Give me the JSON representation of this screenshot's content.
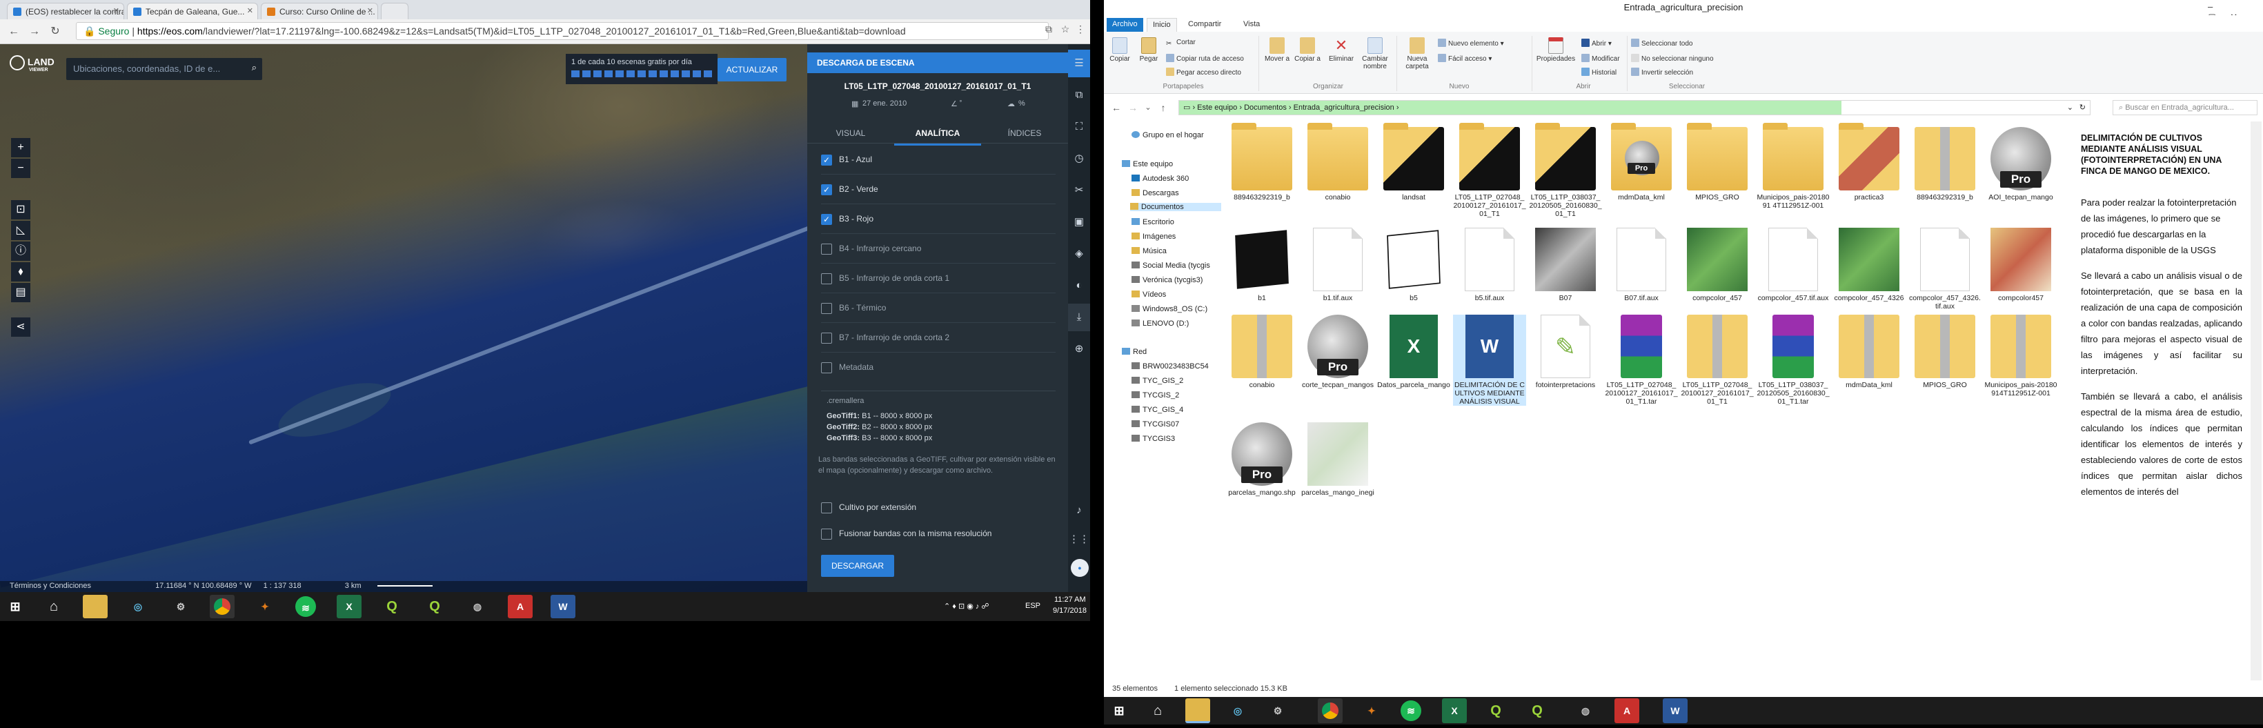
{
  "browser": {
    "tabs": [
      {
        "title": "(EOS) restablecer la contra..."
      },
      {
        "title": "Tecpán de Galeana, Gue..."
      },
      {
        "title": "Curso: Curso Online de ..."
      }
    ],
    "secure_label": "Seguro",
    "url_host": "https://eos.com",
    "url_path": "/landviewer/?lat=17.21197&lng=-100.68249&z=12&s=Landsat5(TM)&id=LT05_L1TP_027048_20100127_20161017_01_T1&b=Red,Green,Blue&anti&tab=download"
  },
  "map": {
    "logo_text": "LAND",
    "logo_sub": "VIEWER",
    "search_placeholder": "Ubicaciones, coordenadas, ID de e...",
    "promo_text": "1 de cada 10 escenas gratis por día",
    "update_button": "ACTUALIZAR",
    "status_terms": "Términos y Condiciones",
    "status_coords": "17.11684 ° N 100.68489 ° W",
    "status_scale": "1 : 137 318",
    "status_distance": "3 km"
  },
  "panel": {
    "header": "DESCARGA DE ESCENA",
    "scene_id": "LT05_L1TP_027048_20100127_20161017_01_T1",
    "date": "27 ene. 2010",
    "cloud": "%",
    "tabs": [
      "VISUAL",
      "ANALÍTICA",
      "ÍNDICES"
    ],
    "bands": [
      {
        "label": "B1 - Azul",
        "checked": true
      },
      {
        "label": "B2 - Verde",
        "checked": true
      },
      {
        "label": "B3 - Rojo",
        "checked": true
      },
      {
        "label": "B4 - Infrarrojo cercano",
        "checked": false
      },
      {
        "label": "B5 - Infrarrojo de onda corta 1",
        "checked": false
      },
      {
        "label": "B6 - Térmico",
        "checked": false
      },
      {
        "label": "B7 - Infrarrojo de onda corta 2",
        "checked": false
      },
      {
        "label": "Metadata",
        "checked": false
      }
    ],
    "zip_title": ".cremallera",
    "zip_lines": [
      {
        "name": "GeoTiff1:",
        "value": "B1 -- 8000 x 8000 px"
      },
      {
        "name": "GeoTiff2:",
        "value": "B2 -- 8000 x 8000 px"
      },
      {
        "name": "GeoTiff3:",
        "value": "B3 -- 8000 x 8000 px"
      }
    ],
    "note": "Las bandas seleccionadas a GeoTIFF, cultivar por extensión visible en el mapa (opcionalmente) y descargar como archivo.",
    "options": [
      "Cultivo por extensión",
      "Fusionar bandas con la misma resolución"
    ],
    "download_button": "DESCARGAR"
  },
  "taskbar_left": {
    "lang": "ESP",
    "time": "11:27 AM",
    "date": "9/17/2018"
  },
  "explorer": {
    "title": "Entrada_agricultura_precision",
    "tabs": [
      "Archivo",
      "Inicio",
      "Compartir",
      "Vista"
    ],
    "ribbon": {
      "copiar": "Copiar",
      "pegar": "Pegar",
      "cortar": "Cortar",
      "copiar_ruta": "Copiar ruta de acceso",
      "pegar_acceso": "Pegar acceso directo",
      "mover": "Mover a",
      "copiar_a": "Copiar a",
      "eliminar": "Eliminar",
      "cambiar": "Cambiar nombre",
      "nueva_carpeta": "Nueva carpeta",
      "nuevo_elemento": "Nuevo elemento",
      "facil_acceso": "Fácil acceso",
      "propiedades": "Propiedades",
      "abrir": "Abrir",
      "modificar": "Modificar",
      "historial": "Historial",
      "sel_todo": "Seleccionar todo",
      "no_sel": "No seleccionar ninguno",
      "invertir": "Invertir selección",
      "groups": [
        "Portapapeles",
        "Organizar",
        "Nuevo",
        "Abrir",
        "Seleccionar"
      ]
    },
    "breadcrumb": [
      "Este equipo",
      "Documentos",
      "Entrada_agricultura_precision"
    ],
    "search_placeholder": "Buscar en Entrada_agricultura...",
    "nav": [
      "Grupo en el hogar",
      "Este equipo",
      "Autodesk 360",
      "Descargas",
      "Documentos",
      "Escritorio",
      "Imágenes",
      "Música",
      "Social Media (tycgis",
      "Verónica (tycgis3)",
      "Vídeos",
      "Windows8_OS (C:)",
      "LENOVO (D:)",
      "Red",
      "BRW0023483BC54",
      "TYC_GIS_2",
      "TYCGIS_2",
      "TYC_GIS_4",
      "TYCGIS07",
      "TYCGIS3"
    ],
    "files": [
      {
        "name": "889463292319_b",
        "kind": "folder"
      },
      {
        "name": "conabio",
        "kind": "folder"
      },
      {
        "name": "landsat",
        "kind": "folder-dark"
      },
      {
        "name": "LT05_L1TP_027048_20100127_20161017_01_T1",
        "kind": "folder-dark"
      },
      {
        "name": "LT05_L1TP_038037_20120505_20160830_01_T1",
        "kind": "folder-dark"
      },
      {
        "name": "mdmData_kml",
        "kind": "folder-globe"
      },
      {
        "name": "MPIOS_GRO",
        "kind": "folder"
      },
      {
        "name": "Municipos_pais-2018091 4T112951Z-001",
        "kind": "folder"
      },
      {
        "name": "practica3",
        "kind": "folder-red"
      },
      {
        "name": "889463292319_b",
        "kind": "zip"
      },
      {
        "name": "AOI_tecpan_mango",
        "kind": "globe"
      },
      {
        "name": "b1",
        "kind": "img-black"
      },
      {
        "name": "b1.tif.aux",
        "kind": "doc"
      },
      {
        "name": "b5",
        "kind": "img-white"
      },
      {
        "name": "b5.tif.aux",
        "kind": "doc"
      },
      {
        "name": "B07",
        "kind": "img-gray"
      },
      {
        "name": "B07.tif.aux",
        "kind": "doc"
      },
      {
        "name": "compcolor_457",
        "kind": "img-green"
      },
      {
        "name": "compcolor_457.tif.aux",
        "kind": "doc"
      },
      {
        "name": "compcolor_457_4326",
        "kind": "img-green"
      },
      {
        "name": "compcolor_457_4326.tif.aux",
        "kind": "doc"
      },
      {
        "name": "compcolor457",
        "kind": "img-red"
      },
      {
        "name": "conabio",
        "kind": "zip"
      },
      {
        "name": "corte_tecpan_mangos",
        "kind": "globe"
      },
      {
        "name": "Datos_parcela_mango",
        "kind": "xls"
      },
      {
        "name": "DELIMITACIÓN DE CULTIVOS MEDIANTE ANÁLISIS VISUAL",
        "kind": "word"
      },
      {
        "name": "fotointerpretacions",
        "kind": "qgis"
      },
      {
        "name": "LT05_L1TP_027048_20100127_20161017_01_T1.tar",
        "kind": "rar"
      },
      {
        "name": "LT05_L1TP_027048_20100127_20161017_01_T1",
        "kind": "zip"
      },
      {
        "name": "LT05_L1TP_038037_20120505_20160830_01_T1.tar",
        "kind": "rar"
      },
      {
        "name": "mdmData_kml",
        "kind": "zip"
      },
      {
        "name": "MPIOS_GRO",
        "kind": "zip"
      },
      {
        "name": "Municipos_pais-20180914T112951Z-001",
        "kind": "zip"
      },
      {
        "name": "parcelas_mango.shp",
        "kind": "globe"
      },
      {
        "name": "parcelas_mango_inegi",
        "kind": "img-light"
      }
    ],
    "preview": {
      "heading": "DELIMITACIÓN DE CULTIVOS MEDIANTE ANÁLISIS VISUAL (FOTOINTERPRETACIÓN) EN UNA FINCA DE MANGO DE MEXICO.",
      "p1": "Para poder realzar la fotointerpretación de las imágenes, lo primero que se procedió fue descargarlas en la plataforma disponible de la USGS",
      "p2": "Se llevará a cabo un análisis visual o de fotointerpretación, que se basa en la realización de una capa de composición a color con bandas realzadas, aplicando filtro para mejoras el aspecto visual de las imágenes y así facilitar su interpretación.",
      "p3": "También se llevará a cabo, el análisis espectral de la misma área de estudio, calculando los índices que permitan identificar los elementos de interés y estableciendo valores de corte de estos índices que permitan aislar dichos elementos de interés del"
    },
    "status_count": "35 elementos",
    "status_selected": "1 elemento seleccionado  15.3 KB"
  }
}
